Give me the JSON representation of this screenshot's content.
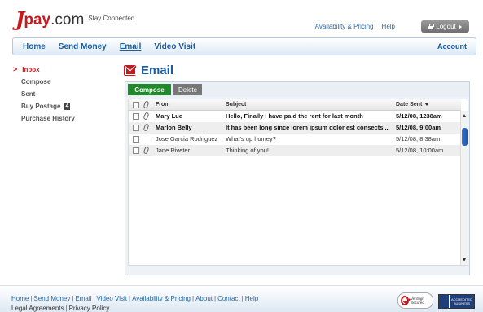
{
  "header": {
    "logo_j": "J",
    "logo_pay": "pay",
    "logo_com": ".com",
    "tagline": "Stay Connected",
    "links": [
      "Availability & Pricing",
      "Help"
    ],
    "logout_label": "Logout"
  },
  "nav": {
    "items": [
      "Home",
      "Send Money",
      "Email",
      "Video Visit"
    ],
    "active": "Email",
    "account_label": "Account"
  },
  "sidebar": {
    "items": [
      {
        "label": "Inbox",
        "active": true
      },
      {
        "label": "Compose"
      },
      {
        "label": "Sent"
      },
      {
        "label": "Buy Postage",
        "badge": "4"
      },
      {
        "label": "Purchase History"
      }
    ]
  },
  "page": {
    "title": "Email",
    "compose_label": "Compose",
    "delete_label": "Delete"
  },
  "table": {
    "columns": {
      "from": "From",
      "subject": "Subject",
      "date": "Date Sent"
    },
    "rows": [
      {
        "from": "Mary Lue",
        "subject": "Hello, Finally I have paid the rent for last month",
        "date": "5/12/08, 1238am",
        "unread": true,
        "attachment": true
      },
      {
        "from": "Marlon Belly",
        "subject": "It has been long since lorem ipsum dolor est consects...",
        "date": "5/12/08, 9:00am",
        "unread": true,
        "attachment": true
      },
      {
        "from": "Jose Garcia Rodriguez",
        "subject": "What's up homey?",
        "date": "5/12/08, 8:38am",
        "unread": false,
        "attachment": false
      },
      {
        "from": "Jane Riveter",
        "subject": "Thinking of you!",
        "date": "5/12/08, 10:00am",
        "unread": false,
        "attachment": true
      }
    ]
  },
  "footer": {
    "links": [
      "Home",
      "Send Money",
      "Email",
      "Video Visit",
      "Availability & Pricing",
      "About",
      "Contact",
      "Help"
    ],
    "links2": [
      "Legal Agreements",
      "Privacy Policy"
    ],
    "verisign_text": "VeriSign Secured",
    "bbb_text": "ACCREDITED BUSINESS"
  },
  "colors": {
    "brand_red": "#c8191e",
    "link_blue": "#1b5c9e",
    "compose_green": "#1f8a2a"
  }
}
